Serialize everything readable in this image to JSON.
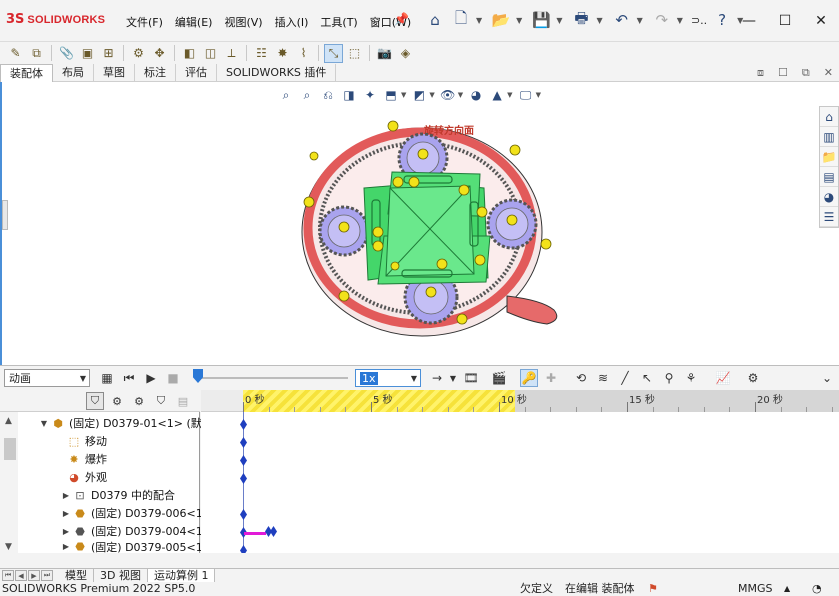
{
  "app": {
    "logo_text": "SOLIDWORKS",
    "logo_mark": "3S"
  },
  "menu": [
    "文件(F)",
    "编辑(E)",
    "视图(V)",
    "插入(I)",
    "工具(T)",
    "窗口(W)"
  ],
  "quickbar": {
    "truncated_text": "⊃.."
  },
  "command_tabs": [
    "装配体",
    "布局",
    "草图",
    "标注",
    "评估",
    "SOLIDWORKS 插件"
  ],
  "model": {
    "label": "旋转方向面"
  },
  "motion": {
    "study_type": "动画",
    "speed": "1x",
    "timeline_labels": [
      "0 秒",
      "5 秒",
      "10 秒",
      "15 秒",
      "20 秒"
    ],
    "tree": [
      {
        "expander": "▼",
        "icon": "assembly-icon",
        "label": "(固定) D0379-01<1> (默认"
      },
      {
        "expander": "",
        "icon": "camera-move-icon",
        "label": "移动"
      },
      {
        "expander": "",
        "icon": "explode-icon",
        "label": "爆炸"
      },
      {
        "expander": "",
        "icon": "appearance-icon",
        "label": "外观"
      },
      {
        "expander": "▶",
        "icon": "mates-folder-icon",
        "label": "D0379 中的配合"
      },
      {
        "expander": "▶",
        "icon": "part-icon",
        "label": "(固定) D0379-006<1:"
      },
      {
        "expander": "▶",
        "icon": "part-icon",
        "label": "(固定) D0379-004<1:"
      },
      {
        "expander": "▶",
        "icon": "part-icon",
        "label": "(固定) D0379-005<1:"
      }
    ]
  },
  "bottom_tabs": [
    "模型",
    "3D 视图",
    "运动算例 1"
  ],
  "status": {
    "product": "SOLIDWORKS Premium 2022 SP5.0",
    "defined": "欠定义",
    "editing": "在编辑 装配体",
    "units": "MMGS"
  },
  "colors": {
    "accent": "#4a8fd8",
    "logo_red": "#d8262c",
    "ring_red": "#e25a5a",
    "plate_green": "#44d66a",
    "gear_blue": "#a9a3ee",
    "ball_yellow": "#f2e21a"
  }
}
